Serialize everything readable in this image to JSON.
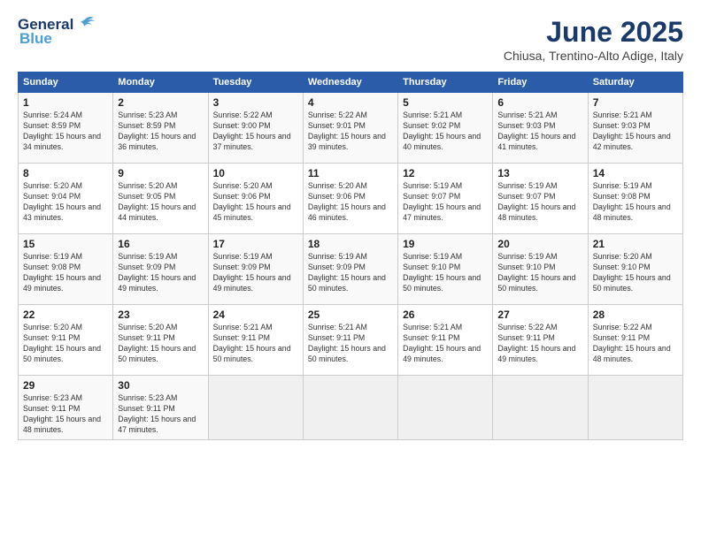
{
  "header": {
    "logo_general": "General",
    "logo_blue": "Blue",
    "month_title": "June 2025",
    "location": "Chiusa, Trentino-Alto Adige, Italy"
  },
  "weekdays": [
    "Sunday",
    "Monday",
    "Tuesday",
    "Wednesday",
    "Thursday",
    "Friday",
    "Saturday"
  ],
  "weeks": [
    [
      {
        "day": "1",
        "sunrise": "Sunrise: 5:24 AM",
        "sunset": "Sunset: 8:59 PM",
        "daylight": "Daylight: 15 hours and 34 minutes."
      },
      {
        "day": "2",
        "sunrise": "Sunrise: 5:23 AM",
        "sunset": "Sunset: 8:59 PM",
        "daylight": "Daylight: 15 hours and 36 minutes."
      },
      {
        "day": "3",
        "sunrise": "Sunrise: 5:22 AM",
        "sunset": "Sunset: 9:00 PM",
        "daylight": "Daylight: 15 hours and 37 minutes."
      },
      {
        "day": "4",
        "sunrise": "Sunrise: 5:22 AM",
        "sunset": "Sunset: 9:01 PM",
        "daylight": "Daylight: 15 hours and 39 minutes."
      },
      {
        "day": "5",
        "sunrise": "Sunrise: 5:21 AM",
        "sunset": "Sunset: 9:02 PM",
        "daylight": "Daylight: 15 hours and 40 minutes."
      },
      {
        "day": "6",
        "sunrise": "Sunrise: 5:21 AM",
        "sunset": "Sunset: 9:03 PM",
        "daylight": "Daylight: 15 hours and 41 minutes."
      },
      {
        "day": "7",
        "sunrise": "Sunrise: 5:21 AM",
        "sunset": "Sunset: 9:03 PM",
        "daylight": "Daylight: 15 hours and 42 minutes."
      }
    ],
    [
      {
        "day": "8",
        "sunrise": "Sunrise: 5:20 AM",
        "sunset": "Sunset: 9:04 PM",
        "daylight": "Daylight: 15 hours and 43 minutes."
      },
      {
        "day": "9",
        "sunrise": "Sunrise: 5:20 AM",
        "sunset": "Sunset: 9:05 PM",
        "daylight": "Daylight: 15 hours and 44 minutes."
      },
      {
        "day": "10",
        "sunrise": "Sunrise: 5:20 AM",
        "sunset": "Sunset: 9:06 PM",
        "daylight": "Daylight: 15 hours and 45 minutes."
      },
      {
        "day": "11",
        "sunrise": "Sunrise: 5:20 AM",
        "sunset": "Sunset: 9:06 PM",
        "daylight": "Daylight: 15 hours and 46 minutes."
      },
      {
        "day": "12",
        "sunrise": "Sunrise: 5:19 AM",
        "sunset": "Sunset: 9:07 PM",
        "daylight": "Daylight: 15 hours and 47 minutes."
      },
      {
        "day": "13",
        "sunrise": "Sunrise: 5:19 AM",
        "sunset": "Sunset: 9:07 PM",
        "daylight": "Daylight: 15 hours and 48 minutes."
      },
      {
        "day": "14",
        "sunrise": "Sunrise: 5:19 AM",
        "sunset": "Sunset: 9:08 PM",
        "daylight": "Daylight: 15 hours and 48 minutes."
      }
    ],
    [
      {
        "day": "15",
        "sunrise": "Sunrise: 5:19 AM",
        "sunset": "Sunset: 9:08 PM",
        "daylight": "Daylight: 15 hours and 49 minutes."
      },
      {
        "day": "16",
        "sunrise": "Sunrise: 5:19 AM",
        "sunset": "Sunset: 9:09 PM",
        "daylight": "Daylight: 15 hours and 49 minutes."
      },
      {
        "day": "17",
        "sunrise": "Sunrise: 5:19 AM",
        "sunset": "Sunset: 9:09 PM",
        "daylight": "Daylight: 15 hours and 49 minutes."
      },
      {
        "day": "18",
        "sunrise": "Sunrise: 5:19 AM",
        "sunset": "Sunset: 9:09 PM",
        "daylight": "Daylight: 15 hours and 50 minutes."
      },
      {
        "day": "19",
        "sunrise": "Sunrise: 5:19 AM",
        "sunset": "Sunset: 9:10 PM",
        "daylight": "Daylight: 15 hours and 50 minutes."
      },
      {
        "day": "20",
        "sunrise": "Sunrise: 5:19 AM",
        "sunset": "Sunset: 9:10 PM",
        "daylight": "Daylight: 15 hours and 50 minutes."
      },
      {
        "day": "21",
        "sunrise": "Sunrise: 5:20 AM",
        "sunset": "Sunset: 9:10 PM",
        "daylight": "Daylight: 15 hours and 50 minutes."
      }
    ],
    [
      {
        "day": "22",
        "sunrise": "Sunrise: 5:20 AM",
        "sunset": "Sunset: 9:11 PM",
        "daylight": "Daylight: 15 hours and 50 minutes."
      },
      {
        "day": "23",
        "sunrise": "Sunrise: 5:20 AM",
        "sunset": "Sunset: 9:11 PM",
        "daylight": "Daylight: 15 hours and 50 minutes."
      },
      {
        "day": "24",
        "sunrise": "Sunrise: 5:21 AM",
        "sunset": "Sunset: 9:11 PM",
        "daylight": "Daylight: 15 hours and 50 minutes."
      },
      {
        "day": "25",
        "sunrise": "Sunrise: 5:21 AM",
        "sunset": "Sunset: 9:11 PM",
        "daylight": "Daylight: 15 hours and 50 minutes."
      },
      {
        "day": "26",
        "sunrise": "Sunrise: 5:21 AM",
        "sunset": "Sunset: 9:11 PM",
        "daylight": "Daylight: 15 hours and 49 minutes."
      },
      {
        "day": "27",
        "sunrise": "Sunrise: 5:22 AM",
        "sunset": "Sunset: 9:11 PM",
        "daylight": "Daylight: 15 hours and 49 minutes."
      },
      {
        "day": "28",
        "sunrise": "Sunrise: 5:22 AM",
        "sunset": "Sunset: 9:11 PM",
        "daylight": "Daylight: 15 hours and 48 minutes."
      }
    ],
    [
      {
        "day": "29",
        "sunrise": "Sunrise: 5:23 AM",
        "sunset": "Sunset: 9:11 PM",
        "daylight": "Daylight: 15 hours and 48 minutes."
      },
      {
        "day": "30",
        "sunrise": "Sunrise: 5:23 AM",
        "sunset": "Sunset: 9:11 PM",
        "daylight": "Daylight: 15 hours and 47 minutes."
      },
      null,
      null,
      null,
      null,
      null
    ]
  ]
}
